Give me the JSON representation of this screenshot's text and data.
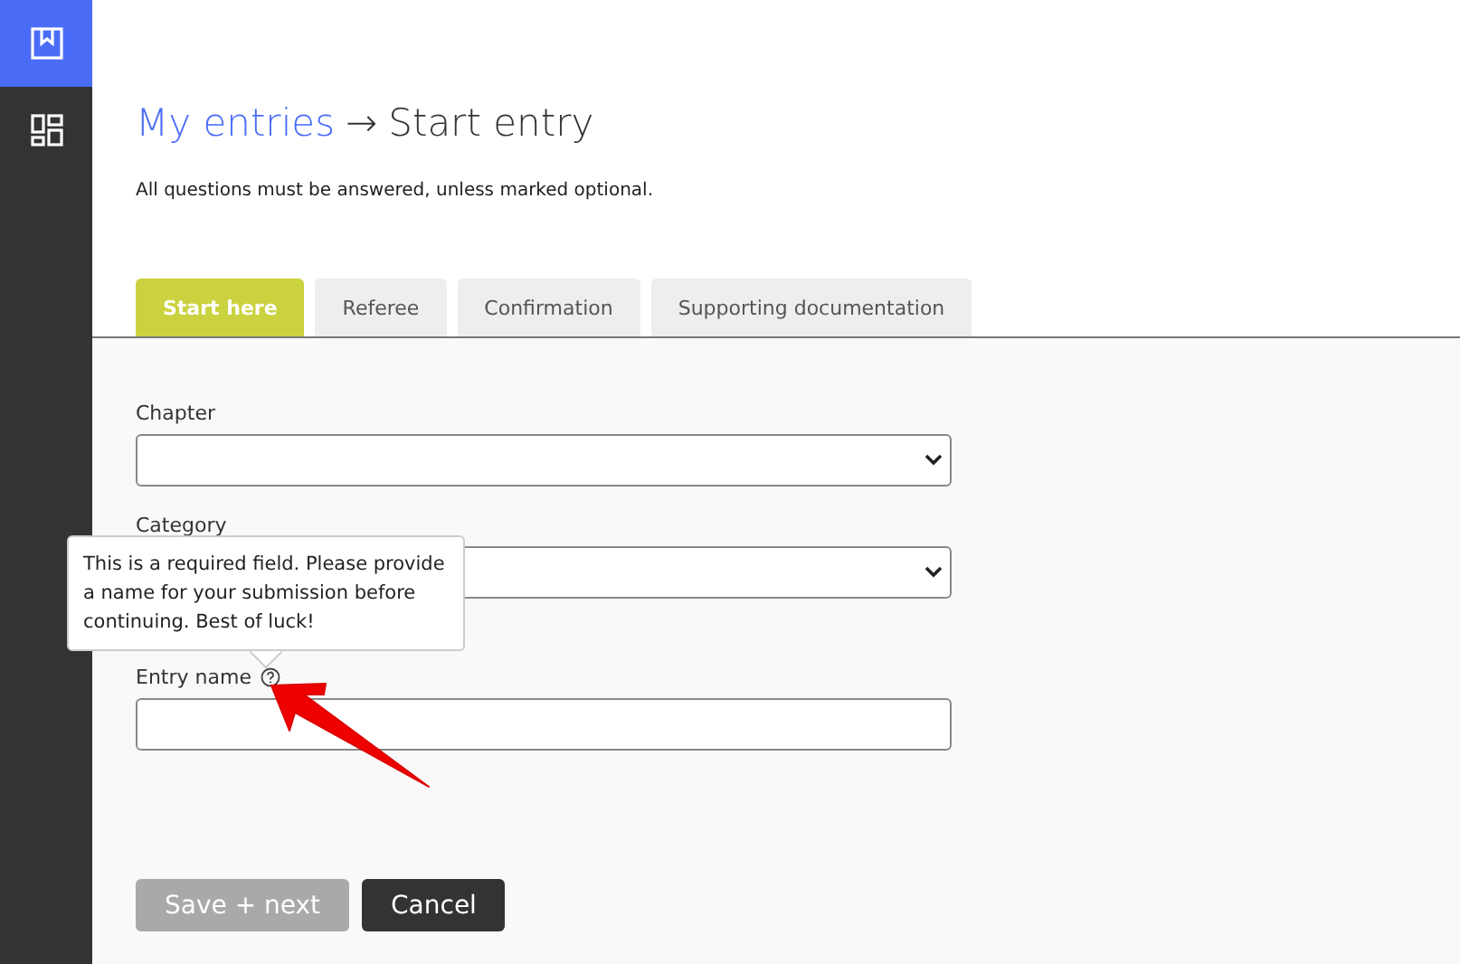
{
  "sidebar": {
    "items": [
      {
        "kind": "bookmark",
        "selected": true
      },
      {
        "kind": "dashboard",
        "selected": false
      }
    ]
  },
  "breadcrumb": {
    "link": "My entries",
    "separator": "→",
    "current": "Start entry"
  },
  "intro": "All questions must be answered, unless marked optional.",
  "tabs": [
    {
      "label": "Start here",
      "selected": true
    },
    {
      "label": "Referee",
      "selected": false
    },
    {
      "label": "Confirmation",
      "selected": false
    },
    {
      "label": "Supporting documentation",
      "selected": false
    }
  ],
  "fields": [
    {
      "label": "Chapter",
      "kind": "select",
      "help": false
    },
    {
      "label": "Category",
      "kind": "select",
      "help": false
    },
    {
      "label": "Entry name",
      "kind": "text",
      "help": true
    }
  ],
  "tooltip": "This is a required field. Please provide a name for your submission before continuing. Best of luck!",
  "buttons": [
    {
      "label": "Save + next",
      "disabled": true
    },
    {
      "label": "Cancel",
      "disabled": false
    }
  ]
}
